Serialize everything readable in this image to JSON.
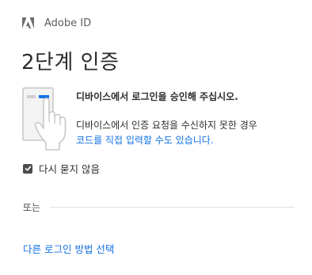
{
  "brand": {
    "name": "Adobe ID",
    "logo_icon": "adobe-logo-icon"
  },
  "title": "2단계 인증",
  "illustration_icon": "device-tap-icon",
  "message": {
    "bold": "디바이스에서 로그인을 승인해 주십시오.",
    "line1": "디바이스에서 인증 요청을 수신하지 못한 경우",
    "link": "코드를 직접 입력할 수도 있습니다."
  },
  "remember": {
    "label": "다시 묻지 않음",
    "checked": true
  },
  "divider": {
    "or_text": "또는"
  },
  "other_method_link": "다른 로그인 방법 선택",
  "colors": {
    "link": "#1473e6",
    "text": "#2c2c2c",
    "muted": "#5e5e5e",
    "checkbox": "#4b4b4b",
    "illustration_blue": "#1473e6"
  }
}
